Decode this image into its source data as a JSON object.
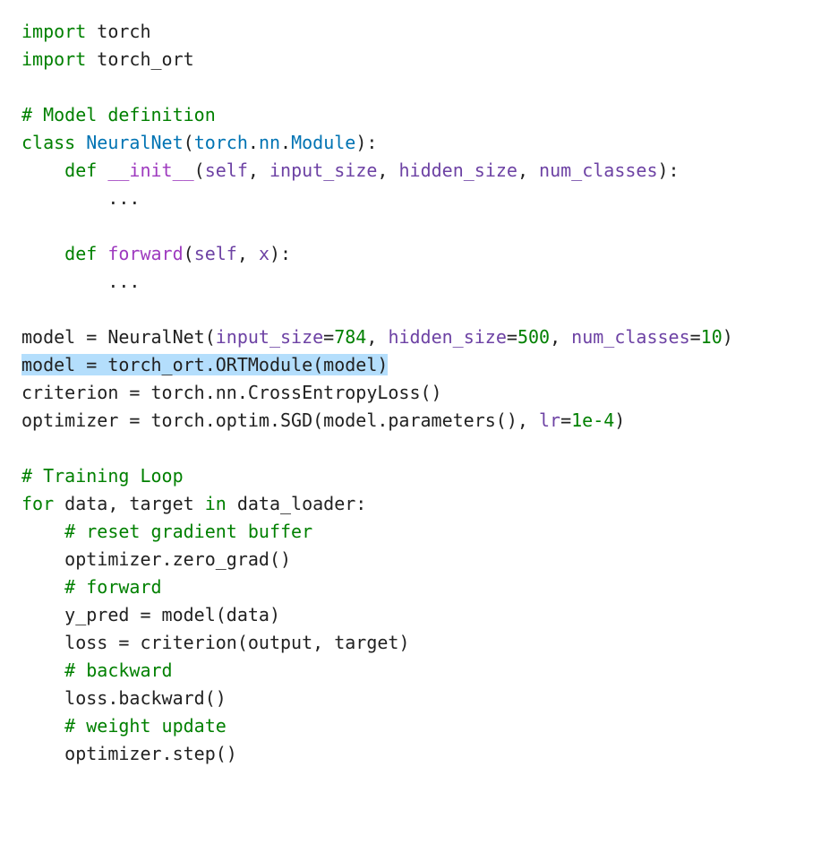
{
  "code": {
    "l1_kw1": "import",
    "l1_mod": " torch",
    "l2_kw1": "import",
    "l2_mod": " torch_ort",
    "l4_comment": "# Model definition",
    "l5_kw1": "class",
    "l5_cls": "NeuralNet",
    "l5_open": "(",
    "l5_base": "torch",
    "l5_dot1": ".",
    "l5_nn": "nn",
    "l5_dot2": ".",
    "l5_module": "Module",
    "l5_close": "):",
    "l6_indent": "    ",
    "l6_kw": "def ",
    "l6_fn": "__init__",
    "l6_open": "(",
    "l6_self": "self",
    "l6_c1": ", ",
    "l6_p1": "input_size",
    "l6_c2": ", ",
    "l6_p2": "hidden_size",
    "l6_c3": ", ",
    "l6_p3": "num_classes",
    "l6_close": "):",
    "l7_indent": "        ",
    "l7_body": "...",
    "l9_indent": "    ",
    "l9_kw": "def ",
    "l9_fn": "forward",
    "l9_open": "(",
    "l9_self": "self",
    "l9_c1": ", ",
    "l9_p1": "x",
    "l9_close": "):",
    "l10_indent": "        ",
    "l10_body": "...",
    "l12_a": "model = NeuralNet(",
    "l12_p1": "input_size",
    "l12_eq1": "=",
    "l12_v1": "784",
    "l12_c1": ", ",
    "l12_p2": "hidden_size",
    "l12_eq2": "=",
    "l12_v2": "500",
    "l12_c2": ", ",
    "l12_p3": "num_classes",
    "l12_eq3": "=",
    "l12_v3": "10",
    "l12_close": ")",
    "l13_full": "model = torch_ort.ORTModule(model)",
    "l14_full": "criterion = torch.nn.CrossEntropyLoss()",
    "l15_a": "optimizer = torch.optim.SGD(model.parameters(), ",
    "l15_p1": "lr",
    "l15_eq1": "=",
    "l15_v1": "1e-4",
    "l15_close": ")",
    "l17_comment": "# Training Loop",
    "l18_kw1": "for",
    "l18_mid": " data, target ",
    "l18_kw2": "in",
    "l18_rest": " data_loader:",
    "l19_indent": "    ",
    "l19_comment": "# reset gradient buffer",
    "l20_indent": "    ",
    "l20_body": "optimizer.zero_grad()",
    "l21_indent": "    ",
    "l21_comment": "# forward",
    "l22_indent": "    ",
    "l22_body": "y_pred = model(data)",
    "l23_indent": "    ",
    "l23_body": "loss = criterion(output, target)",
    "l24_indent": "    ",
    "l24_comment": "# backward",
    "l25_indent": "    ",
    "l25_body": "loss.backward()",
    "l26_indent": "    ",
    "l26_comment": "# weight update",
    "l27_indent": "    ",
    "l27_body": "optimizer.step()"
  }
}
